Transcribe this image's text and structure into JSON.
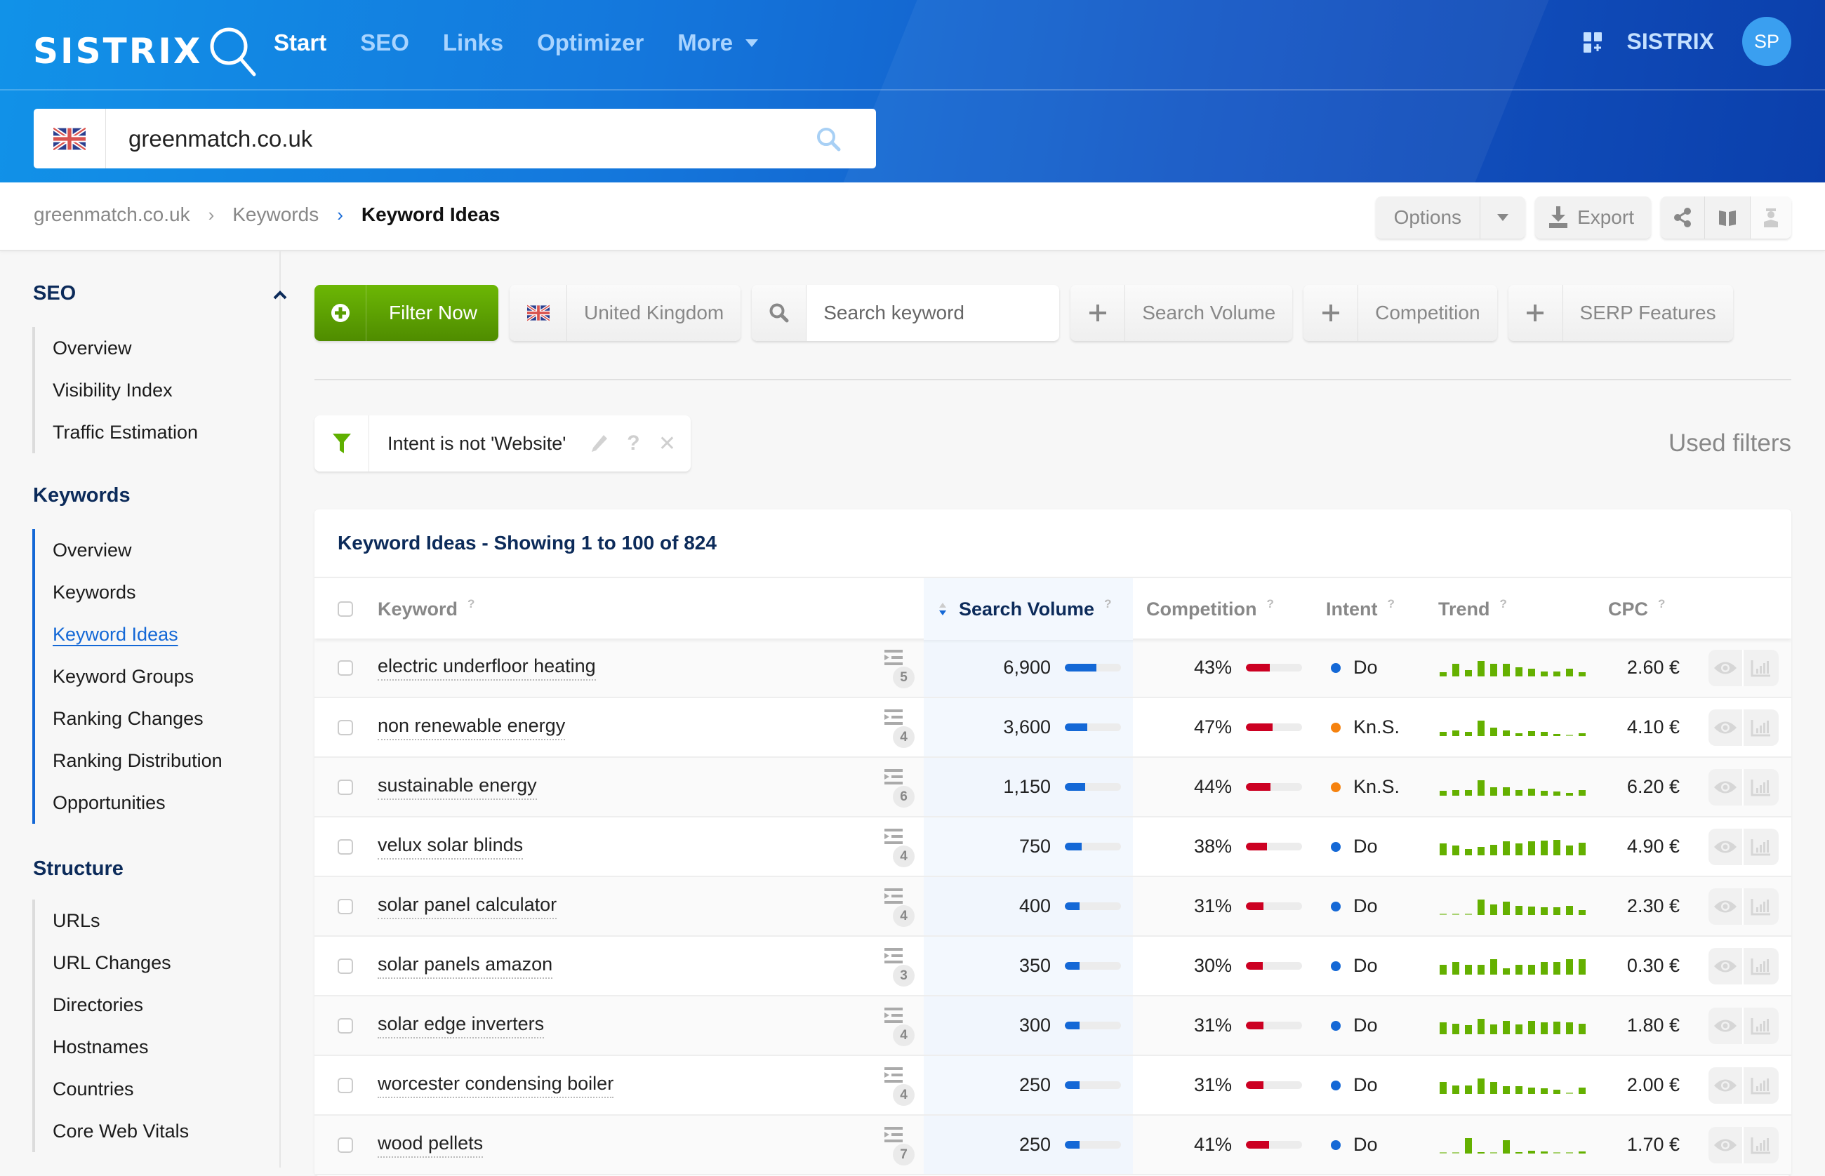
{
  "header": {
    "brand": "SISTRIX",
    "nav": [
      {
        "label": "Start",
        "active": true
      },
      {
        "label": "SEO",
        "active": false
      },
      {
        "label": "Links",
        "active": false
      },
      {
        "label": "Optimizer",
        "active": false
      },
      {
        "label": "More",
        "active": false,
        "dropdown": true
      }
    ],
    "apps_icon": "apps-grid-icon",
    "brand_link": "SISTRIX",
    "avatar_initials": "SP",
    "domain_search": {
      "country_flag": "uk-flag-icon",
      "value": "greenmatch.co.uk",
      "icon": "search-icon"
    }
  },
  "breadcrumb": {
    "items": [
      "greenmatch.co.uk",
      "Keywords"
    ],
    "current": "Keyword Ideas"
  },
  "toolbar": {
    "options_label": "Options",
    "export_label": "Export",
    "icons": [
      "share-icon",
      "book-icon",
      "academy-icon"
    ]
  },
  "sidebar": {
    "sections": [
      {
        "title": "SEO",
        "collapsible": true,
        "items": [
          "Overview",
          "Visibility Index",
          "Traffic Estimation"
        ]
      },
      {
        "title": "Keywords",
        "items": [
          "Overview",
          "Keywords",
          "Keyword Ideas",
          "Keyword Groups",
          "Ranking Changes",
          "Ranking Distribution",
          "Opportunities"
        ],
        "current": "Keyword Ideas"
      },
      {
        "title": "Structure",
        "items": [
          "URLs",
          "URL Changes",
          "Directories",
          "Hostnames",
          "Countries",
          "Core Web Vitals"
        ]
      }
    ]
  },
  "filters": {
    "filter_now_label": "Filter Now",
    "country_label": "United Kingdom",
    "search_placeholder": "Search keyword",
    "search_value": "",
    "add_filters": [
      "Search Volume",
      "Competition",
      "SERP Features"
    ],
    "used_filter": "Intent is not 'Website'",
    "used_filters_label": "Used filters"
  },
  "table": {
    "title": "Keyword Ideas - Showing 1 to 100 of 824",
    "columns": {
      "keyword": "Keyword",
      "search_volume": "Search Volume",
      "competition": "Competition",
      "intent": "Intent",
      "trend": "Trend",
      "cpc": "CPC",
      "help": "?"
    },
    "sorted_column": "search_volume",
    "colors": {
      "volume_bar": "#1468d6",
      "competition_bar": "#cc0022",
      "intent_do": "#1468d6",
      "intent_kns": "#f5820f",
      "trend": "#64b000"
    },
    "rows": [
      {
        "keyword": "electric underfloor heating",
        "serp_features": "5",
        "volume": "6,900",
        "volume_pct": 56,
        "competition": "43%",
        "competition_pct": 43,
        "intent": "Do",
        "intent_type": "do",
        "trend": [
          0.25,
          0.8,
          0.4,
          1.0,
          0.8,
          0.8,
          0.6,
          0.5,
          0.3,
          0.3,
          0.5,
          0.25
        ],
        "cpc": "2.60 €"
      },
      {
        "keyword": "non renewable energy",
        "serp_features": "4",
        "volume": "3,600",
        "volume_pct": 40,
        "competition": "47%",
        "competition_pct": 47,
        "intent": "Kn.S.",
        "intent_type": "kns",
        "trend": [
          0.25,
          0.35,
          0.25,
          1.0,
          0.55,
          0.35,
          0.2,
          0.3,
          0.25,
          0.15,
          0.05,
          0.2
        ],
        "cpc": "4.10 €"
      },
      {
        "keyword": "sustainable energy",
        "serp_features": "6",
        "volume": "1,150",
        "volume_pct": 36,
        "competition": "44%",
        "competition_pct": 44,
        "intent": "Kn.S.",
        "intent_type": "kns",
        "trend": [
          0.3,
          0.35,
          0.35,
          1.0,
          0.55,
          0.55,
          0.35,
          0.45,
          0.3,
          0.25,
          0.2,
          0.35
        ],
        "cpc": "6.20 €"
      },
      {
        "keyword": "velux solar blinds",
        "serp_features": "4",
        "volume": "750",
        "volume_pct": 30,
        "competition": "38%",
        "competition_pct": 38,
        "intent": "Do",
        "intent_type": "do",
        "trend": [
          0.75,
          0.65,
          0.4,
          0.55,
          0.7,
          0.9,
          0.75,
          0.9,
          0.95,
          1.0,
          0.65,
          0.8
        ],
        "cpc": "4.90 €"
      },
      {
        "keyword": "solar panel calculator",
        "serp_features": "4",
        "volume": "400",
        "volume_pct": 26,
        "competition": "31%",
        "competition_pct": 31,
        "intent": "Do",
        "intent_type": "do",
        "trend": [
          0.08,
          0.08,
          0.08,
          1.0,
          0.7,
          0.85,
          0.6,
          0.55,
          0.5,
          0.5,
          0.6,
          0.3
        ],
        "cpc": "2.30 €"
      },
      {
        "keyword": "solar panels amazon",
        "serp_features": "3",
        "volume": "350",
        "volume_pct": 26,
        "competition": "30%",
        "competition_pct": 30,
        "intent": "Do",
        "intent_type": "do",
        "trend": [
          0.65,
          0.8,
          0.65,
          0.65,
          1.0,
          0.4,
          0.65,
          0.65,
          0.8,
          0.8,
          1.0,
          1.0
        ],
        "cpc": "0.30 €"
      },
      {
        "keyword": "solar edge inverters",
        "serp_features": "4",
        "volume": "300",
        "volume_pct": 26,
        "competition": "31%",
        "competition_pct": 31,
        "intent": "Do",
        "intent_type": "do",
        "trend": [
          0.75,
          0.7,
          0.6,
          1.0,
          0.65,
          0.85,
          0.65,
          0.85,
          0.75,
          0.8,
          0.75,
          0.7
        ],
        "cpc": "1.80 €"
      },
      {
        "keyword": "worcester condensing boiler",
        "serp_features": "4",
        "volume": "250",
        "volume_pct": 26,
        "competition": "31%",
        "competition_pct": 31,
        "intent": "Do",
        "intent_type": "do",
        "trend": [
          0.75,
          0.55,
          0.55,
          1.0,
          0.75,
          0.5,
          0.5,
          0.4,
          0.35,
          0.25,
          0.05,
          0.4
        ],
        "cpc": "2.00 €"
      },
      {
        "keyword": "wood pellets",
        "serp_features": "7",
        "volume": "250",
        "volume_pct": 26,
        "competition": "41%",
        "competition_pct": 41,
        "intent": "Do",
        "intent_type": "do",
        "trend": [
          0.05,
          0.08,
          1.0,
          0.1,
          0.03,
          0.85,
          0.1,
          0.18,
          0.12,
          0.08,
          0.08,
          0.15
        ],
        "cpc": "1.70 €"
      }
    ]
  }
}
